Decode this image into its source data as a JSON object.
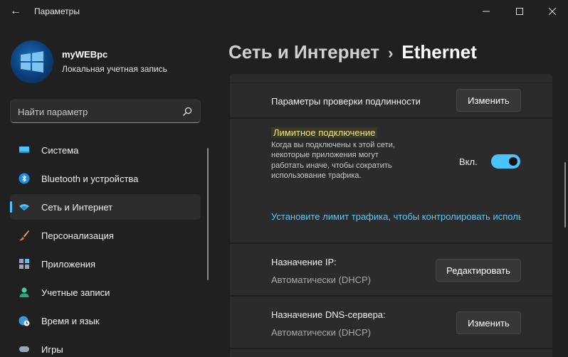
{
  "window": {
    "title": "Параметры",
    "back_icon": "arrow-left-icon",
    "controls": [
      "minimize-icon",
      "maximize-icon",
      "close-icon"
    ]
  },
  "profile": {
    "name": "myWEBpc",
    "account_type": "Локальная учетная запись"
  },
  "search": {
    "placeholder": "Найти параметр",
    "icon": "search-icon"
  },
  "sidebar": {
    "items": [
      {
        "label": "Система",
        "icon": "monitor-icon",
        "active": false
      },
      {
        "label": "Bluetooth и устройства",
        "icon": "bluetooth-icon",
        "active": false
      },
      {
        "label": "Сеть и Интернет",
        "icon": "network-icon",
        "active": true
      },
      {
        "label": "Персонализация",
        "icon": "brush-icon",
        "active": false
      },
      {
        "label": "Приложения",
        "icon": "apps-icon",
        "active": false
      },
      {
        "label": "Учетные записи",
        "icon": "user-icon",
        "active": false
      },
      {
        "label": "Время и язык",
        "icon": "globe-clock-icon",
        "active": false
      },
      {
        "label": "Игры",
        "icon": "gamepad-icon",
        "active": false
      }
    ]
  },
  "header": {
    "parent": "Сеть и Интернет",
    "separator": "›",
    "current": "Ethernet"
  },
  "settings": {
    "auth": {
      "label": "Параметры проверки подлинности",
      "button": "Изменить"
    },
    "metered": {
      "title": "Лимитное подключение",
      "description": "Когда вы подключены к этой сети, некоторые приложения могут работать иначе, чтобы сократить использование трафика.",
      "toggle_state": "Вкл.",
      "toggle_on": true,
      "link": "Установите лимит трафика, чтобы контролировать использование данных в этой сети"
    },
    "ip": {
      "label": "Назначение IP:",
      "value": "Автоматически (DHCP)",
      "button": "Редактировать"
    },
    "dns": {
      "label": "Назначение DNS-сервера:",
      "value": "Автоматически (DHCP)",
      "button": "Изменить"
    }
  },
  "colors": {
    "background": "#202020",
    "card": "#2b2b2b",
    "accent": "#4cc2ff",
    "link": "#5fc6f5",
    "highlight_text": "#f0e68c"
  }
}
